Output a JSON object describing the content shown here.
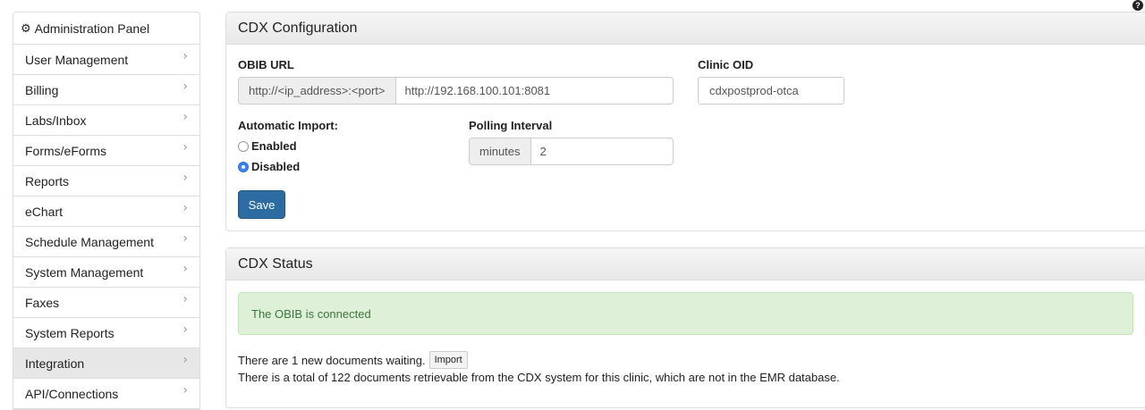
{
  "sidebar": {
    "header": {
      "icon": "gear-icon",
      "title": "Administration Panel"
    },
    "items": [
      {
        "label": "User Management"
      },
      {
        "label": "Billing"
      },
      {
        "label": "Labs/Inbox"
      },
      {
        "label": "Forms/eForms"
      },
      {
        "label": "Reports"
      },
      {
        "label": "eChart"
      },
      {
        "label": "Schedule Management"
      },
      {
        "label": "System Management"
      },
      {
        "label": "Faxes"
      },
      {
        "label": "System Reports"
      },
      {
        "label": "Integration",
        "active": true
      },
      {
        "label": "API/Connections"
      }
    ]
  },
  "config": {
    "title": "CDX Configuration",
    "obib_url_label": "OBIB URL",
    "obib_url_addon": "http://<ip_address>:<port>",
    "obib_url_value": "http://192.168.100.101:8081",
    "clinic_oid_label": "Clinic OID",
    "clinic_oid_value": "cdxpostprod-otca",
    "auto_import_label": "Automatic Import:",
    "auto_import_options": [
      {
        "label": "Enabled",
        "checked": false
      },
      {
        "label": "Disabled",
        "checked": true
      }
    ],
    "polling_label": "Polling Interval",
    "polling_addon": "minutes",
    "polling_value": "2",
    "save_label": "Save"
  },
  "status": {
    "title": "CDX Status",
    "alert": "The OBIB is connected",
    "waiting_text": "There are 1 new documents waiting.",
    "import_label": "Import",
    "total_text": "There is a total of 122 documents retrievable from the CDX system for this clinic, which are not in the EMR database."
  },
  "colors": {
    "accent": "#2d6ca2",
    "success_bg": "#dff0d8",
    "success_text": "#3c763d",
    "radio_selected": "#3b82f6"
  }
}
